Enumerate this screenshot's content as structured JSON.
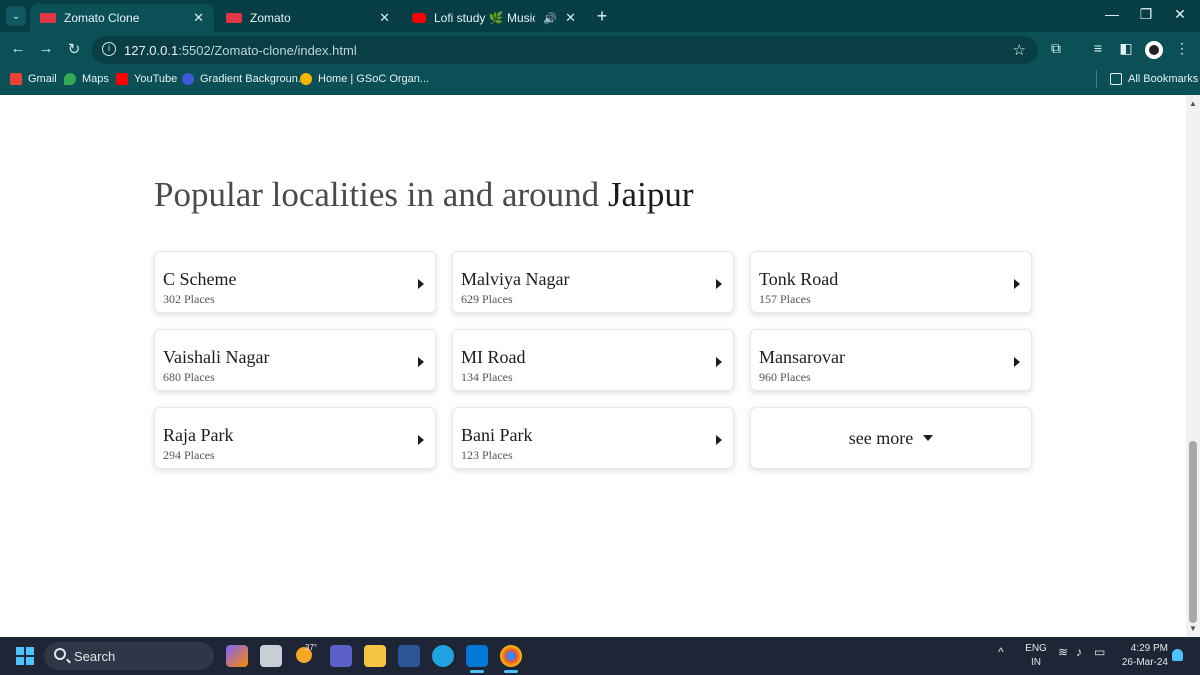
{
  "browser": {
    "tabs": [
      {
        "title": "Zomato Clone",
        "active": true
      },
      {
        "title": "Zomato",
        "active": false
      },
      {
        "title": "Lofi study 🌿 Music that m",
        "active": false
      }
    ],
    "address": {
      "host": "127.0.0.1",
      "path": ":5502/Zomato-clone/index.html"
    },
    "bookmarks": [
      "Gmail",
      "Maps",
      "YouTube",
      "Gradient Backgroun...",
      "Home | GSoC Organ..."
    ],
    "all_bookmarks": "All Bookmarks"
  },
  "page": {
    "heading_prefix": "Popular localities in and around ",
    "heading_city": "Jaipur",
    "localities": [
      {
        "name": "C Scheme",
        "places": "302 Places"
      },
      {
        "name": "Malviya Nagar",
        "places": "629 Places"
      },
      {
        "name": "Tonk Road",
        "places": "157 Places"
      },
      {
        "name": "Vaishali Nagar",
        "places": "680 Places"
      },
      {
        "name": "MI Road",
        "places": "134 Places"
      },
      {
        "name": "Mansarovar",
        "places": "960 Places"
      },
      {
        "name": "Raja Park",
        "places": "294 Places"
      },
      {
        "name": "Bani Park",
        "places": "123 Places"
      }
    ],
    "see_more": "see more"
  },
  "taskbar": {
    "search_label": "Search",
    "weather_temp": "37°",
    "language": {
      "line1": "ENG",
      "line2": "IN"
    },
    "time": "4:29 PM",
    "date": "26-Mar-24"
  },
  "colors": {
    "brand": "#e23744",
    "chrome": "#0b4f57"
  }
}
